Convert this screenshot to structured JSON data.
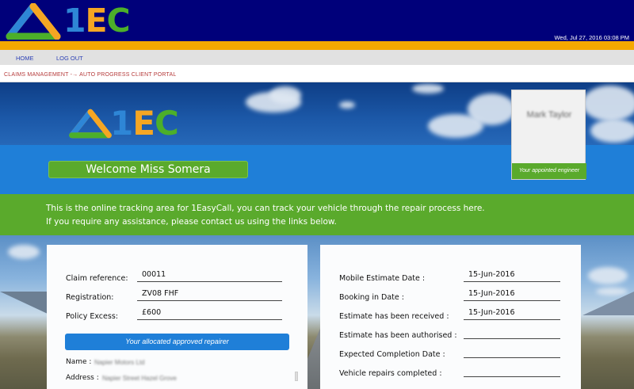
{
  "header": {
    "logo_text": {
      "one": "1",
      "e": "E",
      "c": "C"
    },
    "datetime": "Wed, Jul 27, 2016 03:08 PM",
    "colors": {
      "navy": "#00007a",
      "orange": "#f5a800",
      "blue": "#1f7fd8",
      "green": "#5aaa2c"
    }
  },
  "nav": {
    "home": "HOME",
    "logout": "LOG OUT"
  },
  "breadcrumb": {
    "root": "CLAIMS MANAGEMENT",
    "arrow": "-→",
    "current": "AUTO PROGRESS CLIENT PORTAL"
  },
  "banner": {
    "logo_text": {
      "one": "1",
      "e": "E",
      "c": "C"
    },
    "welcome": "Welcome Miss Somera",
    "engineer_name": "Mark Taylor",
    "engineer_label": "Your appointed engineer"
  },
  "intro": {
    "line1": "This is the online tracking area for 1EasyCall, you can track your vehicle through the repair process here.",
    "line2": "If you require any assistance, please contact us using the links below."
  },
  "claim": {
    "reference_label": "Claim reference:",
    "reference_value": "00011",
    "registration_label": "Registration:",
    "registration_value": "ZV08 FHF",
    "excess_label": "Policy Excess:",
    "excess_value": "£600",
    "repairer_title": "Your allocated approved repairer",
    "name_label": "Name :",
    "name_value": "Napier Motors Ltd",
    "address_label": "Address :",
    "address_value": "Napier Street Hazel Grove"
  },
  "progress": {
    "mobile_estimate_label": "Mobile Estimate Date :",
    "mobile_estimate_value": "15-Jun-2016",
    "booking_label": "Booking in Date :",
    "booking_value": "15-Jun-2016",
    "received_label": "Estimate has been received :",
    "received_value": "15-Jun-2016",
    "authorised_label": "Estimate has been authorised :",
    "authorised_value": "",
    "completion_label": "Expected Completion Date :",
    "completion_value": "",
    "completed_label": "Vehicle repairs completed :",
    "completed_value": ""
  }
}
